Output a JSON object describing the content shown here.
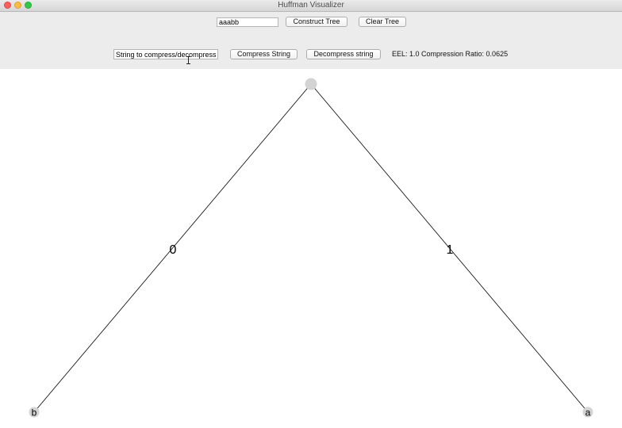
{
  "window": {
    "title": "Huffman Visualizer"
  },
  "toolbar": {
    "tree_input_value": "aaabb",
    "construct_tree_label": "Construct Tree",
    "clear_tree_label": "Clear Tree",
    "compress_input_value": "String to compress/decompress",
    "compress_string_label": "Compress String",
    "decompress_string_label": "Decompress string",
    "status_text": "EEL: 1.0 Compression Ratio: 0.0625"
  },
  "tree": {
    "root": {
      "label": ""
    },
    "left_edge_label": "0",
    "right_edge_label": "1",
    "left_leaf": {
      "label": "b"
    },
    "right_leaf": {
      "label": "a"
    },
    "node_color": "#d3d3d3"
  }
}
